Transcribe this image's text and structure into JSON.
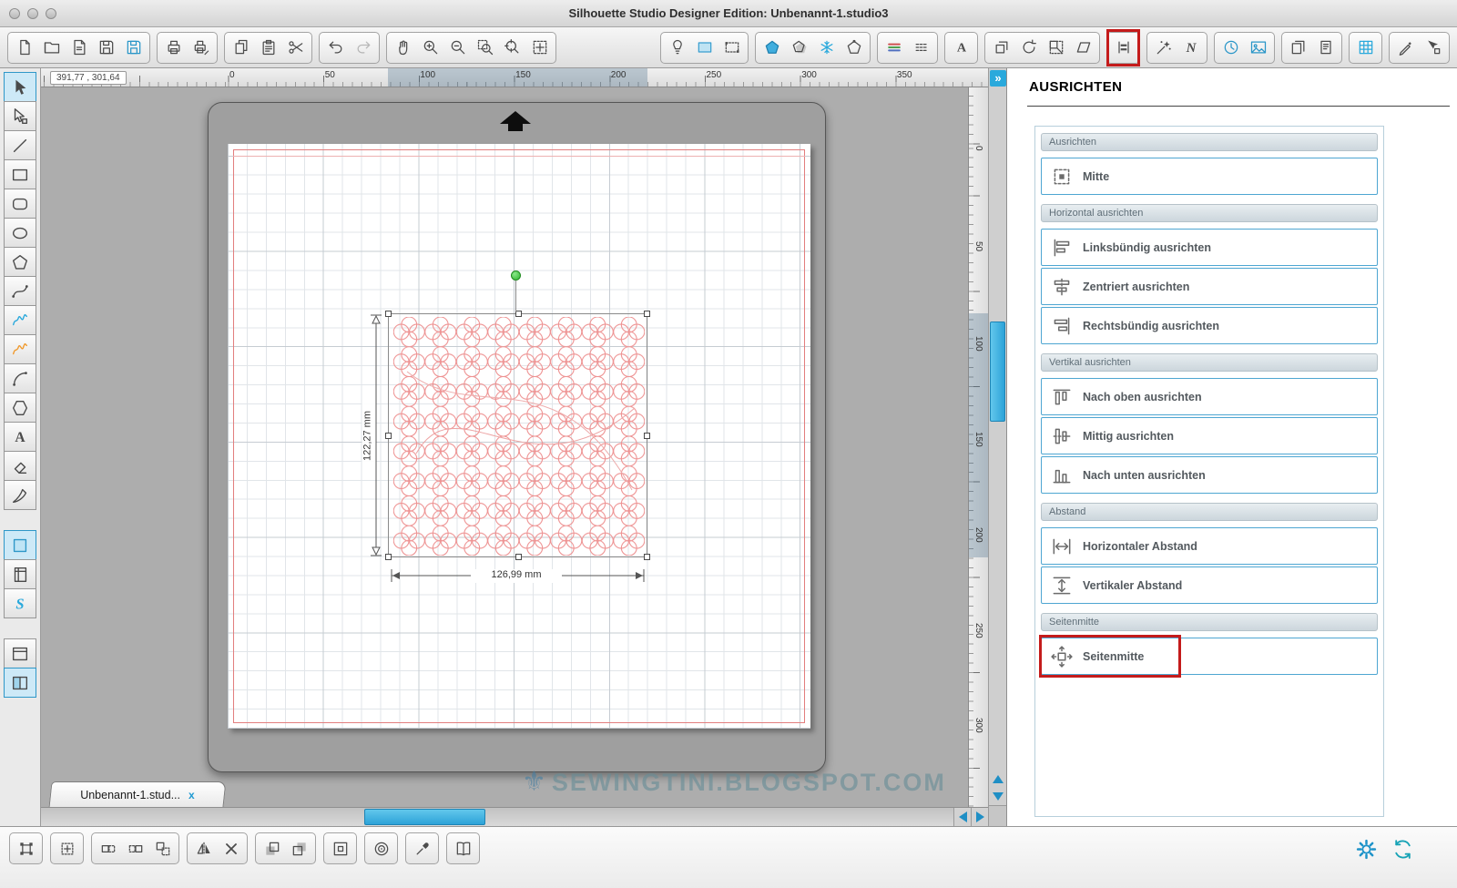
{
  "window": {
    "title": "Silhouette Studio Designer Edition: Unbenannt-1.studio3"
  },
  "colors": {
    "accent": "#2aa9dc",
    "highlight_red": "#c41b1b",
    "design_red": "#ee9393",
    "selection_green": "#3cbf3c"
  },
  "toolbar_top": {
    "groups": [
      [
        {
          "name": "new-document-button",
          "icon": "page"
        },
        {
          "name": "open-button",
          "icon": "folder"
        },
        {
          "name": "open-library-button",
          "icon": "page-corner"
        },
        {
          "name": "save-button",
          "icon": "save"
        },
        {
          "name": "save-as-button",
          "icon": "save",
          "color": "#2a96c8"
        }
      ],
      [
        {
          "name": "print-button",
          "icon": "printer"
        },
        {
          "name": "print-settings-button",
          "icon": "printer-pen"
        }
      ],
      [
        {
          "name": "copy-button",
          "icon": "copy"
        },
        {
          "name": "paste-button",
          "icon": "paste"
        },
        {
          "name": "cut-button",
          "icon": "scissors"
        }
      ],
      [
        {
          "name": "undo-button",
          "icon": "undo"
        },
        {
          "name": "redo-button",
          "icon": "redo",
          "dim": true
        }
      ],
      [
        {
          "name": "pan-tool-button",
          "icon": "hand"
        },
        {
          "name": "zoom-in-button",
          "icon": "zoom-in"
        },
        {
          "name": "zoom-out-button",
          "icon": "zoom-out"
        },
        {
          "name": "zoom-selection-button",
          "icon": "zoom-sel"
        },
        {
          "name": "zoom-drag-button",
          "icon": "zoom-drag"
        },
        {
          "name": "fit-to-page-button",
          "icon": "fit-page"
        }
      ],
      [
        {
          "name": "design-page-settings-button",
          "icon": "lamp"
        },
        {
          "name": "page-setup-button",
          "icon": "blue-rect"
        },
        {
          "name": "registration-marks-button",
          "icon": "dotted-rect"
        }
      ],
      [
        {
          "name": "fill-color-button",
          "icon": "pentagon-fill"
        },
        {
          "name": "fill-gradient-button",
          "icon": "pentagon-shadow"
        },
        {
          "name": "fill-pattern-button",
          "icon": "snowflake",
          "color": "#2aa9dc"
        },
        {
          "name": "line-color-button",
          "icon": "pentagon-dot"
        }
      ],
      [
        {
          "name": "line-color-style-button",
          "icon": "lines-rgb"
        },
        {
          "name": "line-style-button",
          "icon": "dashes"
        }
      ],
      [
        {
          "name": "text-style-button",
          "icon": "letter-a"
        }
      ],
      [
        {
          "name": "modify-button",
          "icon": "weld"
        },
        {
          "name": "rotate-button",
          "icon": "rotate"
        },
        {
          "name": "scale-button",
          "icon": "scale-grid"
        },
        {
          "name": "shear-button",
          "icon": "shear"
        }
      ],
      [
        {
          "name": "align-button",
          "icon": "align",
          "red": true
        }
      ],
      [
        {
          "name": "replicate-button",
          "icon": "scatter"
        },
        {
          "name": "nest-button",
          "icon": "letter-n"
        }
      ],
      [
        {
          "name": "trace-button",
          "icon": "clock",
          "color": "#2a96c8"
        },
        {
          "name": "pixscan-button",
          "icon": "image",
          "color": "#2a96c8"
        }
      ],
      [
        {
          "name": "send-to-silhouette-button",
          "icon": "pages"
        },
        {
          "name": "send-page-button",
          "icon": "page-single"
        }
      ],
      [
        {
          "name": "show-grid-button",
          "icon": "grid",
          "color": "#2aa9dc"
        }
      ],
      [
        {
          "name": "marker-settings-button",
          "icon": "marker"
        },
        {
          "name": "pointer-settings-button",
          "icon": "pointer-square"
        }
      ]
    ]
  },
  "tool_palette": {
    "tools": [
      {
        "name": "select-tool",
        "icon": "cursor",
        "selected": true
      },
      {
        "name": "point-editing-tool",
        "icon": "cursor-node"
      },
      {
        "name": "line-tool",
        "icon": "line"
      },
      {
        "name": "rectangle-tool",
        "icon": "rect"
      },
      {
        "name": "rounded-rectangle-tool",
        "icon": "rrect"
      },
      {
        "name": "ellipse-tool",
        "icon": "ellipse"
      },
      {
        "name": "polygon-tool",
        "icon": "polygon"
      },
      {
        "name": "curve-tool",
        "icon": "curve"
      },
      {
        "name": "freehand-tool",
        "icon": "squiggle",
        "color": "#2aa9dc"
      },
      {
        "name": "smooth-freehand-tool",
        "icon": "squiggle",
        "color": "#f09a2e"
      },
      {
        "name": "arc-tool",
        "icon": "arc"
      },
      {
        "name": "shape-tool",
        "icon": "shape-hex"
      },
      {
        "name": "text-tool",
        "icon": "letter-a"
      },
      {
        "name": "eraser-tool",
        "icon": "eraser"
      },
      {
        "name": "knife-tool",
        "icon": "knife"
      },
      {
        "name": "design-view-button",
        "icon": "fill-square",
        "selected": true,
        "gap": true
      },
      {
        "name": "library-view-button",
        "icon": "notebook"
      },
      {
        "name": "store-view-button",
        "icon": "s-logo"
      },
      {
        "name": "single-window-button",
        "icon": "window",
        "gap": true
      },
      {
        "name": "split-window-button",
        "icon": "split-window",
        "selected": true
      }
    ]
  },
  "canvas": {
    "coordinates": "391,77 , 301,64",
    "h_ruler": [
      "0",
      "50",
      "100",
      "150",
      "200",
      "250",
      "300",
      "350"
    ],
    "v_ruler": [
      "0",
      "50",
      "100",
      "150",
      "200",
      "250",
      "300"
    ],
    "selection": {
      "height_label": "122,27 mm",
      "width_label": "126,99 mm"
    },
    "tab": {
      "label": "Unbenannt-1.stud...",
      "close_label": "x"
    },
    "watermark_icon": "⚜",
    "watermark": "SEWINGTINI.BLOGSPOT.COM",
    "panel_expand_label": "»"
  },
  "align_panel": {
    "title": "AUSRICHTEN",
    "sections": [
      {
        "header": "Ausrichten",
        "buttons": [
          {
            "name": "mitte-button",
            "icon": "al-mitte",
            "label": "Mitte"
          }
        ]
      },
      {
        "header": "Horizontal ausrichten",
        "buttons": [
          {
            "name": "align-left-button",
            "icon": "al-left",
            "label": "Linksbündig ausrichten"
          },
          {
            "name": "align-center-horizontal-button",
            "icon": "al-ch",
            "label": "Zentriert ausrichten"
          },
          {
            "name": "align-right-button",
            "icon": "al-right",
            "label": "Rechtsbündig ausrichten"
          }
        ]
      },
      {
        "header": "Vertikal ausrichten",
        "buttons": [
          {
            "name": "align-top-button",
            "icon": "al-top",
            "label": "Nach oben ausrichten"
          },
          {
            "name": "align-middle-button",
            "icon": "al-cm",
            "label": "Mittig ausrichten"
          },
          {
            "name": "align-bottom-button",
            "icon": "al-bottom",
            "label": "Nach unten ausrichten"
          }
        ]
      },
      {
        "header": "Abstand",
        "buttons": [
          {
            "name": "horizontal-spacing-button",
            "icon": "sp-h",
            "label": "Horizontaler Abstand"
          },
          {
            "name": "vertical-spacing-button",
            "icon": "sp-v",
            "label": "Vertikaler Abstand"
          }
        ]
      },
      {
        "header": "Seitenmitte",
        "buttons": [
          {
            "name": "seitenmitte-button",
            "icon": "center-page",
            "label": "Seitenmitte",
            "red": true
          }
        ]
      }
    ]
  },
  "toolbar_bottom": {
    "groups": [
      [
        {
          "name": "transform-panel-button",
          "icon": "transform"
        }
      ],
      [
        {
          "name": "free-transform-button",
          "icon": "move-grid"
        }
      ],
      [
        {
          "name": "duplicate-left-button",
          "icon": "dup-left"
        },
        {
          "name": "duplicate-right-button",
          "icon": "dup-right"
        },
        {
          "name": "duplicate-multiple-button",
          "icon": "dup-stack"
        }
      ],
      [
        {
          "name": "mirror-button",
          "icon": "mirror"
        },
        {
          "name": "delete-button",
          "icon": "delete-x"
        }
      ],
      [
        {
          "name": "bring-to-front-button",
          "icon": "copies"
        },
        {
          "name": "send-to-back-button",
          "icon": "send-back"
        }
      ],
      [
        {
          "name": "compound-path-button",
          "icon": "compound"
        }
      ],
      [
        {
          "name": "object-target-button",
          "icon": "target"
        }
      ],
      [
        {
          "name": "color-picker-button",
          "icon": "dropper"
        }
      ],
      [
        {
          "name": "style-library-button",
          "icon": "book"
        }
      ]
    ]
  },
  "status_icons": [
    {
      "name": "preferences-button",
      "icon": "gear",
      "color": "#1e93c9"
    },
    {
      "name": "refresh-button",
      "icon": "sync",
      "color": "#17a3b6"
    }
  ]
}
